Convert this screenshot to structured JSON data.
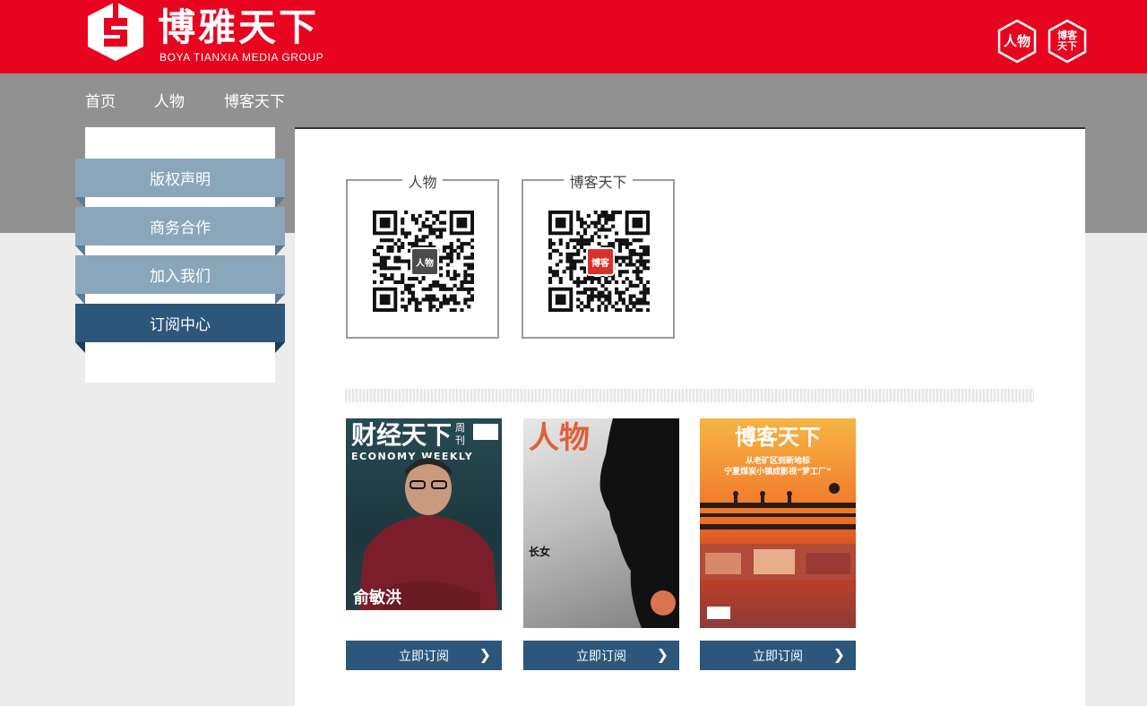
{
  "brand": {
    "name_cn": "博雅天下",
    "name_en": "BOYA TIANXIA MEDIA GROUP",
    "header_color": "#e8041f",
    "icons": [
      {
        "name": "renwu-hex-icon",
        "label": "人物"
      },
      {
        "name": "boke-hex-icon",
        "label": "博客天下"
      }
    ]
  },
  "nav": {
    "items": [
      {
        "label": "首页"
      },
      {
        "label": "人物"
      },
      {
        "label": "博客天下"
      }
    ]
  },
  "sidebar": {
    "items": [
      {
        "label": "版权声明",
        "active": false
      },
      {
        "label": "商务合作",
        "active": false
      },
      {
        "label": "加入我们",
        "active": false
      },
      {
        "label": "订阅中心",
        "active": true
      }
    ],
    "accent": "#2c567a"
  },
  "qrcodes": [
    {
      "title": "人物",
      "logo_text": "人物"
    },
    {
      "title": "博客天下",
      "logo_text": "博客"
    }
  ],
  "magazines": [
    {
      "masthead": "财经天下",
      "masthead_tag": "周刊",
      "subtitle": "ECONOMY WEEKLY",
      "cover_text": "俞敏洪",
      "button_label": "立即订阅"
    },
    {
      "masthead": "人物",
      "cover_text": "长女",
      "button_label": "立即订阅"
    },
    {
      "masthead": "博客天下",
      "headline_1": "从老矿区到新地标",
      "headline_2": "宁夏煤炭小镇成影视“梦工厂”",
      "button_label": "立即订阅"
    }
  ]
}
